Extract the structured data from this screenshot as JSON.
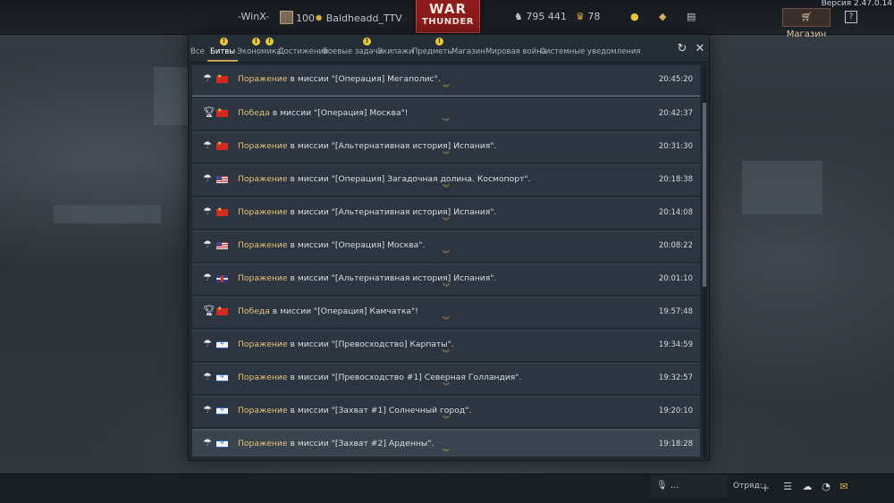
{
  "topbar": {
    "clan_tag": "-WinX-",
    "player_level": "100",
    "player_name": "Baldheadd_TTV",
    "logo_line1": "WAR",
    "logo_line2": "THUNDER",
    "silver_lions": "795 441",
    "golden_eagles": "78",
    "shop_label": "Магазин",
    "version": "Версия 2.47.0.14"
  },
  "tabs": [
    {
      "label": "Все",
      "badge": false,
      "active": false
    },
    {
      "label": "Битвы",
      "badge": true,
      "active": true
    },
    {
      "label": "Экономика",
      "badge": true,
      "active": false
    },
    {
      "label": "Достижения",
      "badge": true,
      "active": false
    },
    {
      "label": "Боевые задачи",
      "badge": false,
      "active": false
    },
    {
      "label": "Экипажи",
      "badge": true,
      "active": false
    },
    {
      "label": "Предметы",
      "badge": true,
      "active": false
    },
    {
      "label": "Магазин",
      "badge": false,
      "active": false
    },
    {
      "label": "Мировая война",
      "badge": false,
      "active": false
    },
    {
      "label": "Системные уведомления",
      "badge": false,
      "active": false
    }
  ],
  "badge_symbol": "!",
  "messages": [
    {
      "result": "Поражение",
      "text": " в миссии \"[Операция] Мегаполис\".",
      "time": "20:45:20",
      "flag": "cn",
      "icon": "parachute-icon"
    },
    {
      "result": "Победа",
      "text": " в миссии \"[Операция] Москва\"!",
      "time": "20:42:37",
      "flag": "cn",
      "icon": "trophy-icon"
    },
    {
      "result": "Поражение",
      "text": " в миссии \"[Альтернативная история] Испания\".",
      "time": "20:31:30",
      "flag": "cn",
      "icon": "parachute-icon"
    },
    {
      "result": "Поражение",
      "text": " в миссии \"[Операция] Загадочная долина. Космопорт\".",
      "time": "20:18:38",
      "flag": "us",
      "icon": "parachute-icon"
    },
    {
      "result": "Поражение",
      "text": " в миссии \"[Альтернативная история] Испания\".",
      "time": "20:14:08",
      "flag": "cn",
      "icon": "parachute-icon"
    },
    {
      "result": "Поражение",
      "text": " в миссии \"[Операция] Москва\".",
      "time": "20:08:22",
      "flag": "us",
      "icon": "parachute-icon"
    },
    {
      "result": "Поражение",
      "text": " в миссии \"[Альтернативная история] Испания\".",
      "time": "20:01:10",
      "flag": "uk",
      "icon": "parachute-icon"
    },
    {
      "result": "Победа",
      "text": " в миссии \"[Операция] Камчатка\"!",
      "time": "19:57:48",
      "flag": "cn",
      "icon": "trophy-icon"
    },
    {
      "result": "Поражение",
      "text": " в миссии \"[Превосходство] Карпаты\".",
      "time": "19:34:59",
      "flag": "il",
      "icon": "parachute-icon"
    },
    {
      "result": "Поражение",
      "text": " в миссии \"[Превосходство #1] Северная Голландия\".",
      "time": "19:32:57",
      "flag": "il",
      "icon": "parachute-icon"
    },
    {
      "result": "Поражение",
      "text": " в миссии \"[Захват #1] Солнечный город\".",
      "time": "19:20:10",
      "flag": "il",
      "icon": "parachute-icon"
    },
    {
      "result": "Поражение",
      "text": " в миссии \"[Захват #2] Арденны\".",
      "time": "19:18:28",
      "flag": "il",
      "icon": "parachute-icon"
    }
  ],
  "bottombar": {
    "voice_label": "...",
    "squad_label": "Отряд:"
  },
  "colors": {
    "result_highlight": "#e6c27a",
    "badge": "#e8c53a",
    "logo_red": "#8d1b1b"
  }
}
